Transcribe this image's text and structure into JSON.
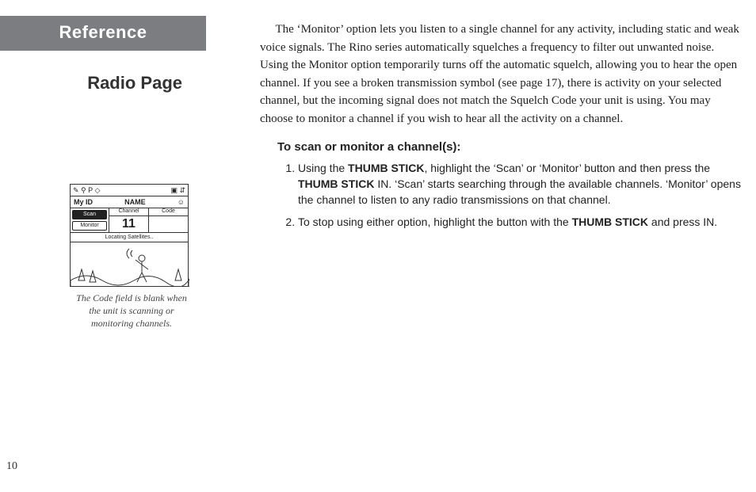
{
  "header": {
    "reference": "Reference",
    "page_title": "Radio Page"
  },
  "figure": {
    "lcd": {
      "topbar_left": "✎ ⚲ P ◇",
      "topbar_right": "▣ ⇵",
      "id_label": "My ID",
      "id_value": "NAME",
      "id_face": "☺",
      "scan_label": "Scan",
      "monitor_label": "Monitor",
      "channel_heading": "Channel",
      "code_heading": "Code",
      "channel_value": "11",
      "code_value": "",
      "status_text": "Locating Satellites.."
    },
    "caption": "The Code field is blank when the unit is scanning or monitoring channels."
  },
  "body": {
    "lead": "The ‘Monitor’ option lets you listen to a single channel for any activity, including static and weak voice signals.  The Rino series automatically squelches a frequency to filter out unwanted noise.  Using the Monitor option temporarily turns off the automatic squelch, allowing you to hear the open channel.  If you see a broken transmission symbol (see page 17), there is activity on your selected channel, but the incoming signal does not match the Squelch Code your unit is using.  You may choose to monitor a channel if you wish to hear all the activity on a channel.",
    "instr_heading": "To scan or monitor a channel(s):",
    "steps": {
      "s1a": "Using the ",
      "s1b": "THUMB STICK",
      "s1c": ", highlight the ‘Scan’ or ‘Monitor’ button and then press the ",
      "s1d": "THUMB STICK",
      "s1e": " IN.  ‘Scan’ starts searching through the available channels.  ‘Monitor’ opens the channel to listen to any radio transmissions on that channel.",
      "s2a": "To stop using either option, highlight the button with the ",
      "s2b": "THUMB STICK",
      "s2c": " and press IN."
    }
  },
  "page_number": "10"
}
